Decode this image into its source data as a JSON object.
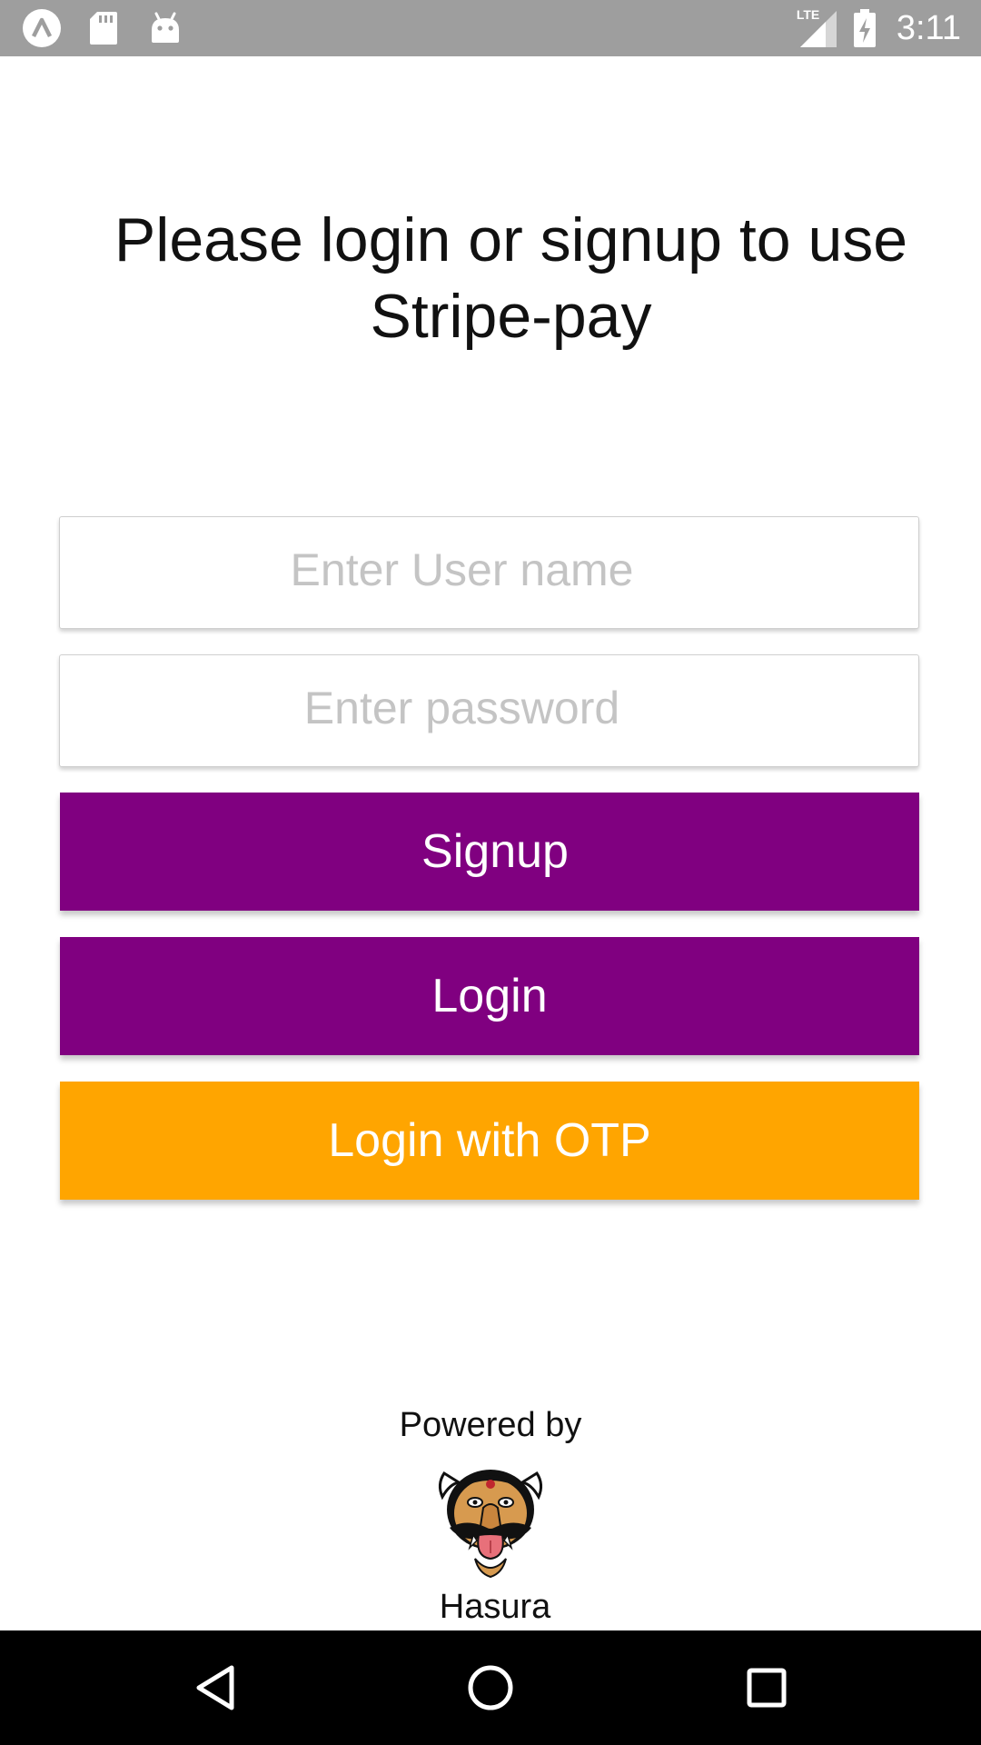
{
  "status_bar": {
    "time": "3:11",
    "network_label": "LTE",
    "left_icons": [
      "app-notification-icon",
      "sd-card-icon",
      "android-icon"
    ],
    "background_color": "#9e9e9e"
  },
  "heading": {
    "text": "Please login or signup to use Stripe-pay"
  },
  "form": {
    "username_placeholder": "Enter User name",
    "password_placeholder": "Enter password"
  },
  "buttons": {
    "signup_label": "Signup",
    "login_label": "Login",
    "otp_label": "Login with OTP"
  },
  "footer": {
    "powered_by": "Powered by",
    "brand": "Hasura"
  },
  "colors": {
    "primary_purple": "#800080",
    "accent_orange": "#ffa500"
  },
  "nav_bar": {
    "icons": [
      "back-icon",
      "home-icon",
      "recents-icon"
    ]
  }
}
